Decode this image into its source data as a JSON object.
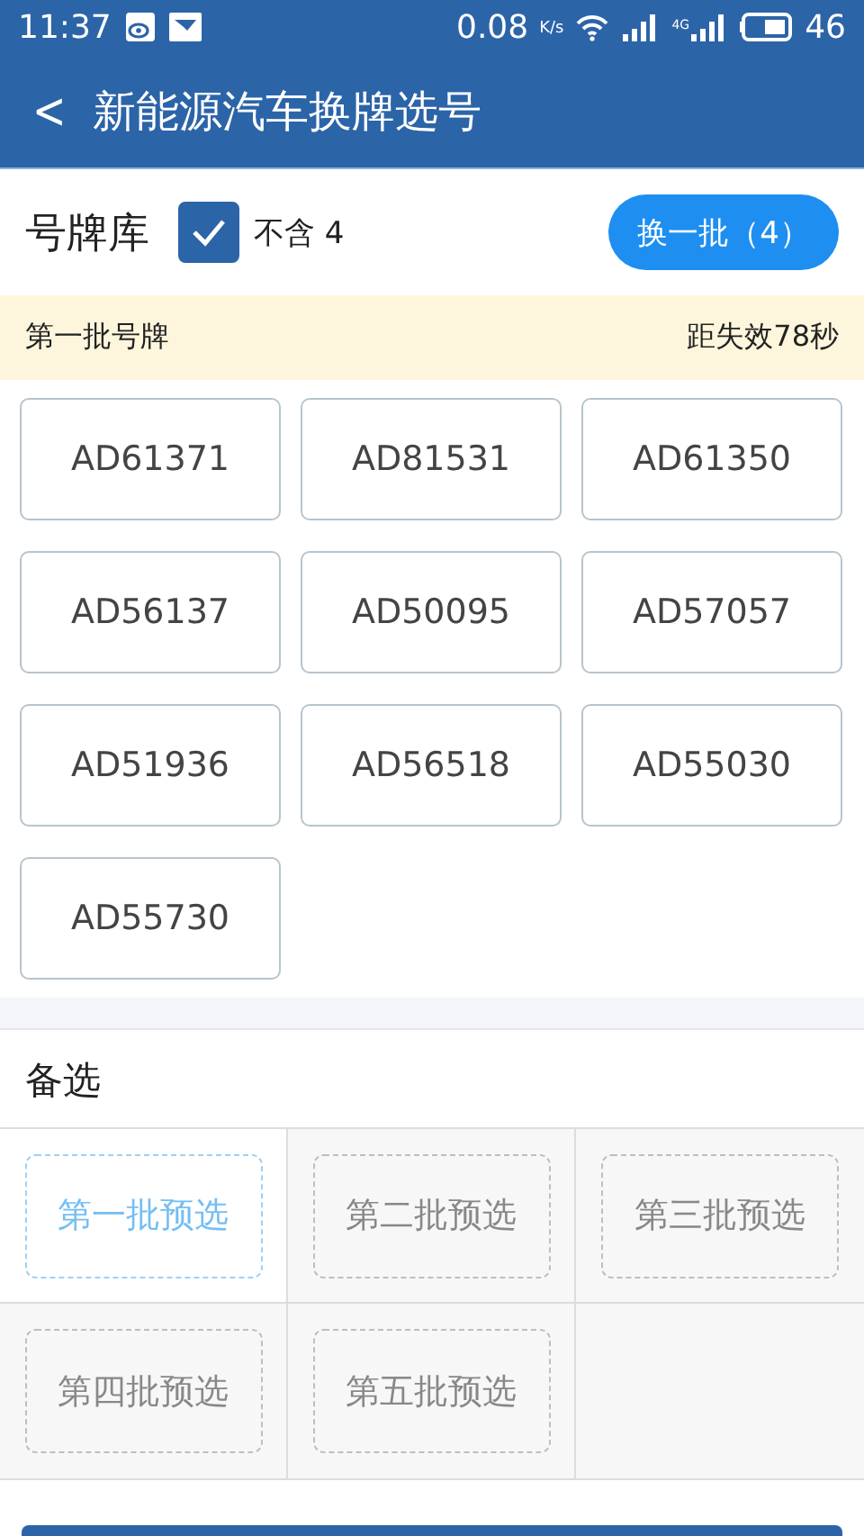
{
  "status_bar": {
    "time": "11:37",
    "speed": "0.08",
    "speed_unit": "K/s",
    "network": "4G",
    "battery": "46"
  },
  "app_bar": {
    "back": "<",
    "title": "新能源汽车换牌选号"
  },
  "library": {
    "title": "号牌库",
    "exclude_four": {
      "checked": true,
      "label": "不含 4"
    },
    "refresh_button": "换一批（4）"
  },
  "batch": {
    "title": "第一批号牌",
    "countdown": "距失效78秒"
  },
  "plates": [
    "AD61371",
    "AD81531",
    "AD61350",
    "AD56137",
    "AD50095",
    "AD57057",
    "AD51936",
    "AD56518",
    "AD55030",
    "AD55730"
  ],
  "alternates": {
    "title": "备选",
    "slots": [
      {
        "label": "第一批预选",
        "selected": true
      },
      {
        "label": "第二批预选",
        "selected": false
      },
      {
        "label": "第三批预选",
        "selected": false
      },
      {
        "label": "第四批预选",
        "selected": false
      },
      {
        "label": "第五批预选",
        "selected": false
      }
    ]
  }
}
